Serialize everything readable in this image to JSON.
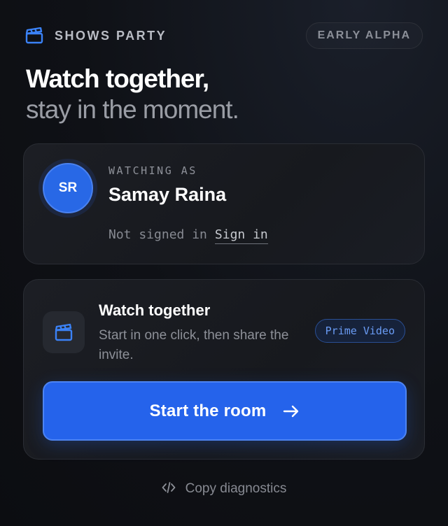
{
  "header": {
    "brand_name": "SHOWS PARTY",
    "brand_icon": "clapperboard-icon",
    "badge": "EARLY ALPHA"
  },
  "hero": {
    "line1": "Watch together,",
    "line2": "stay in the moment."
  },
  "user_card": {
    "avatar_initials": "SR",
    "label": "WATCHING AS",
    "name": "Samay Raina",
    "status": "Not signed in",
    "sign_in_label": "Sign in"
  },
  "watch_card": {
    "icon": "clapperboard-icon",
    "title": "Watch together",
    "description": "Start in one click, then share the invite.",
    "service": "Prime Video",
    "start_label": "Start the room",
    "start_icon": "arrow-right-icon"
  },
  "footer": {
    "diagnostics_icon": "code-icon",
    "diagnostics_label": "Copy diagnostics"
  },
  "colors": {
    "accent": "#2563eb",
    "background": "#0f1116",
    "card": "#1a1c21",
    "pill_text": "#6a9cf5"
  }
}
